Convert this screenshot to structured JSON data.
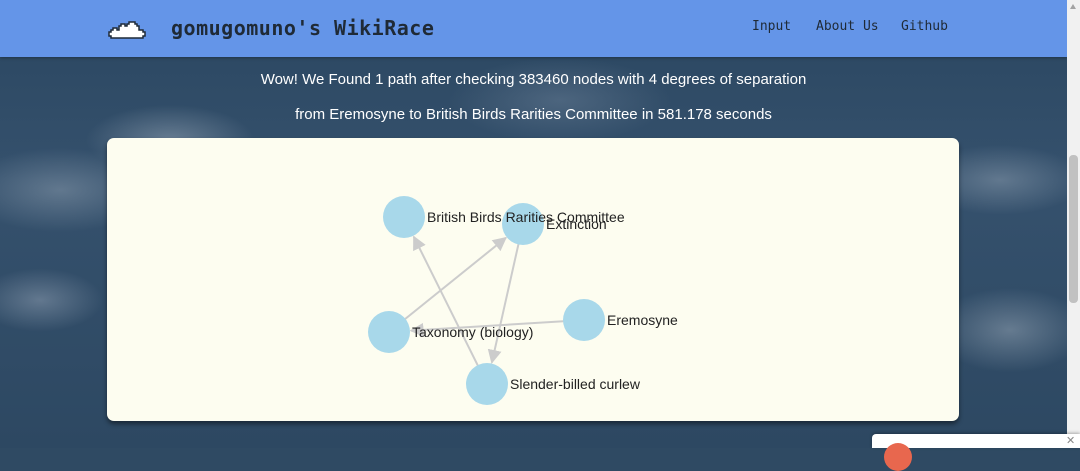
{
  "navbar": {
    "brand": "gomugomuno's WikiRace",
    "logo_icon": "cloud-icon",
    "links": [
      "Input",
      "About Us",
      "Github"
    ]
  },
  "result": {
    "line1": "Wow! We Found 1 path after checking 383460 nodes with 4 degrees of separation",
    "line2": "from Eremosyne to British Birds Rarities Committee in 581.178 seconds"
  },
  "graph": {
    "node_color": "#a8d8ea",
    "edge_color": "#cccccc",
    "nodes": [
      "British Birds Rarities Committee",
      "Extinction",
      "Taxonomy (biology)",
      "Eremosyne",
      "Slender-billed curlew"
    ],
    "edges": [
      [
        "Eremosyne",
        "Taxonomy (biology)"
      ],
      [
        "Taxonomy (biology)",
        "Extinction"
      ],
      [
        "Extinction",
        "Slender-billed curlew"
      ],
      [
        "Slender-billed curlew",
        "British Birds Rarities Committee"
      ]
    ]
  },
  "colors": {
    "navbar": "#6495e8",
    "card": "#fdfdf0",
    "popup_badge": "#e8674e"
  },
  "popup": {
    "close_icon": "close-icon"
  }
}
